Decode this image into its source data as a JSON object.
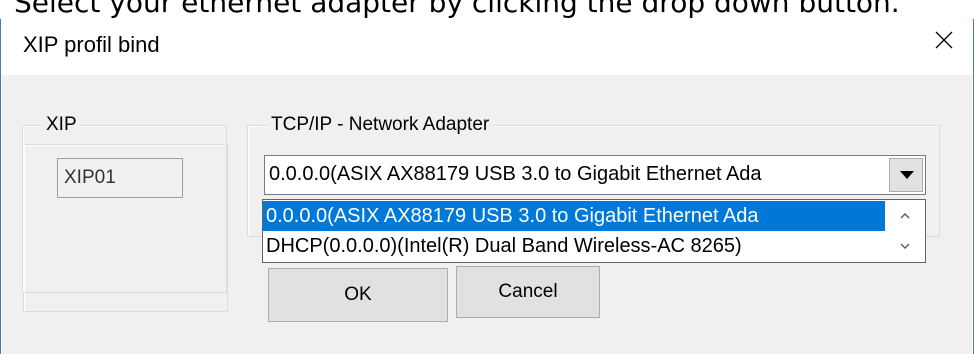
{
  "instruction": "Select your ethernet adapter by clicking the drop down button.",
  "dialog": {
    "title": "XIP profil bind",
    "close_icon": "close-icon"
  },
  "xip_group": {
    "label": "XIP",
    "field_value": "XIP01"
  },
  "adapter_group": {
    "label": "TCP/IP - Network Adapter",
    "selected_value": "0.0.0.0(ASIX AX88179 USB 3.0 to Gigabit Ethernet Ada",
    "options": [
      "0.0.0.0(ASIX AX88179 USB 3.0 to Gigabit Ethernet Ada",
      "DHCP(0.0.0.0)(Intel(R) Dual Band Wireless-AC 8265)"
    ],
    "dropdown_icon": "dropdown-arrow-icon",
    "scroll_up_icon": "scroll-up-icon",
    "scroll_down_icon": "scroll-down-icon"
  },
  "buttons": {
    "ok_label": "OK",
    "cancel_label": "Cancel"
  },
  "colors": {
    "selection": "#0078d7",
    "dialog_border": "#3c7fb1",
    "client_bg": "#f0f0f0"
  }
}
